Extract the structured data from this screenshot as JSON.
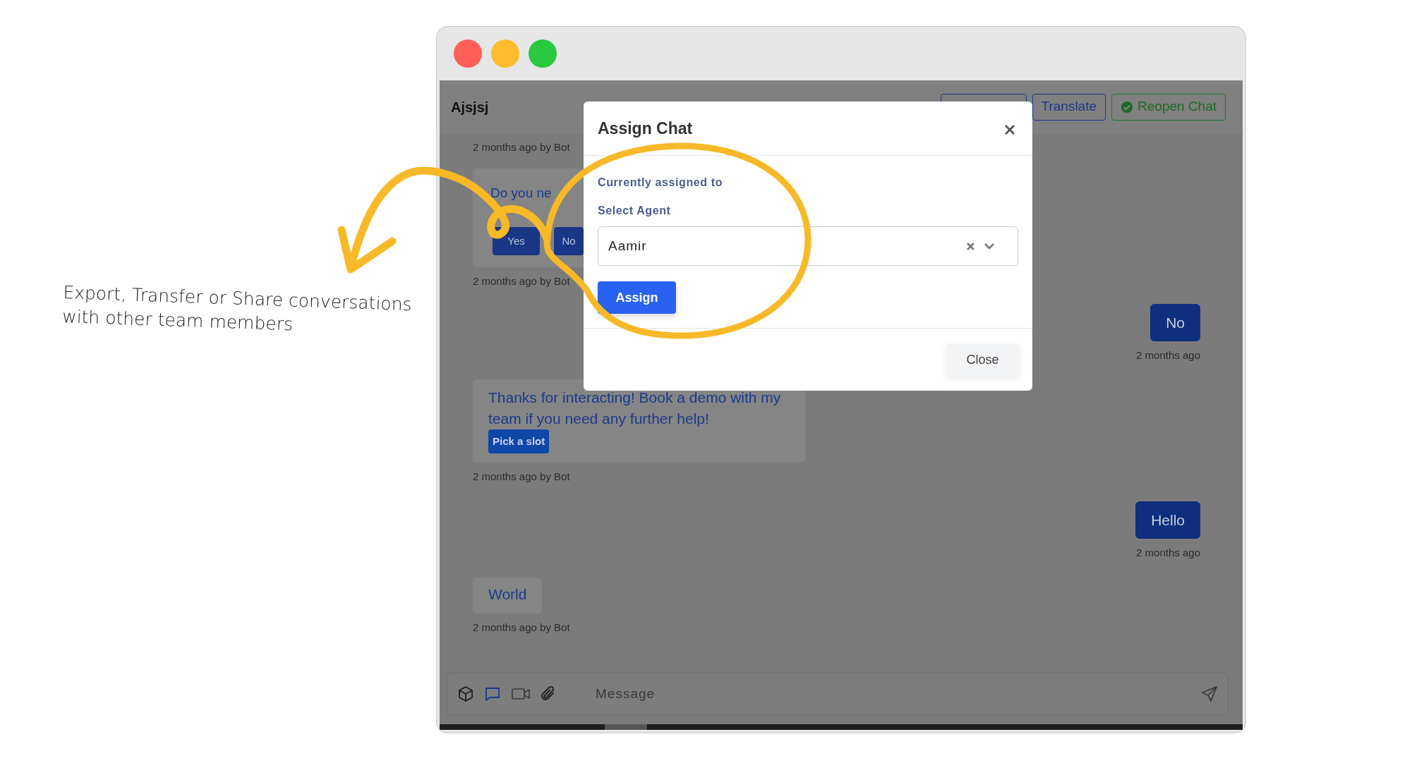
{
  "annotation": {
    "text": "Export, Transfer or Share conversations with other team members"
  },
  "window": {
    "controls": [
      {
        "color": "#ff5f57"
      },
      {
        "color": "#febc2e"
      },
      {
        "color": "#28c840"
      }
    ]
  },
  "chat_header": {
    "title": "Ajsjsj",
    "buttons": [
      {
        "kind": "blank"
      },
      {
        "kind": "translate",
        "label": "Translate"
      },
      {
        "kind": "reopen",
        "label": "Reopen Chat"
      }
    ]
  },
  "messages": [
    {
      "kind": "meta",
      "time": "2 months ago by Bot"
    },
    {
      "kind": "bot",
      "text": "Do you ne",
      "buttons": [
        "Yes",
        "No"
      ],
      "time": "2 months ago by Bot"
    },
    {
      "kind": "user",
      "text": "No",
      "time": "2 months ago"
    },
    {
      "kind": "bot",
      "text": "Thanks for interacting! Book a demo with my team if you need any further help!",
      "tag": "Pick a slot",
      "time": "2 months ago by Bot"
    },
    {
      "kind": "user",
      "text": "Hello",
      "time": "2 months ago"
    },
    {
      "kind": "bot",
      "text": "World",
      "time": "2 months ago by Bot"
    }
  ],
  "composer": {
    "placeholder": "Message"
  },
  "modal": {
    "title": "Assign Chat",
    "current_label": "Currently assigned to",
    "select_label": "Select Agent",
    "select_value": "Aamir",
    "assign_button": "Assign",
    "close_button": "Close"
  }
}
